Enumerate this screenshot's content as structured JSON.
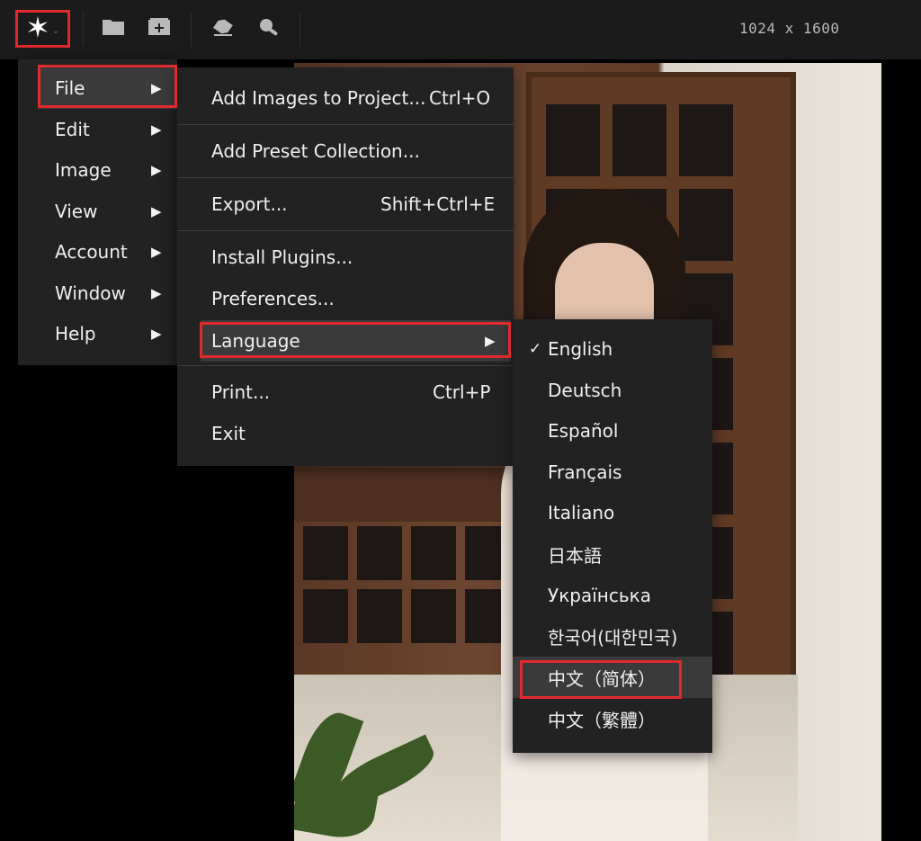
{
  "toolbar": {
    "app_icon": "app-star-icon",
    "icons": [
      "folder-icon",
      "add-image-icon",
      "eraser-icon",
      "zoom-icon"
    ],
    "image_dimensions": "1024 x 1600"
  },
  "main_menu": {
    "items": [
      {
        "label": "File"
      },
      {
        "label": "Edit"
      },
      {
        "label": "Image"
      },
      {
        "label": "View"
      },
      {
        "label": "Account"
      },
      {
        "label": "Window"
      },
      {
        "label": "Help"
      }
    ]
  },
  "file_menu": {
    "items": [
      {
        "label": "Add Images to Project...",
        "shortcut": "Ctrl+O"
      },
      {
        "label": "Add Preset Collection...",
        "shortcut": ""
      },
      {
        "label": "Export...",
        "shortcut": "Shift+Ctrl+E"
      },
      {
        "label": "Install Plugins...",
        "shortcut": ""
      },
      {
        "label": "Preferences...",
        "shortcut": ""
      },
      {
        "label": "Language",
        "shortcut": ""
      },
      {
        "label": "Print...",
        "shortcut": "Ctrl+P"
      },
      {
        "label": "Exit",
        "shortcut": ""
      }
    ]
  },
  "language_menu": {
    "check_mark": "✓",
    "items": [
      {
        "label": "English"
      },
      {
        "label": "Deutsch"
      },
      {
        "label": "Español"
      },
      {
        "label": "Français"
      },
      {
        "label": "Italiano"
      },
      {
        "label": "日本語"
      },
      {
        "label": "Українська"
      },
      {
        "label": "한국어(대한민국)"
      },
      {
        "label": "中文（简体）"
      },
      {
        "label": "中文（繁體）"
      }
    ]
  },
  "colors": {
    "highlight_box": "#e0292d",
    "menu_bg": "#222222",
    "toolbar_bg": "#1b1b1b"
  }
}
